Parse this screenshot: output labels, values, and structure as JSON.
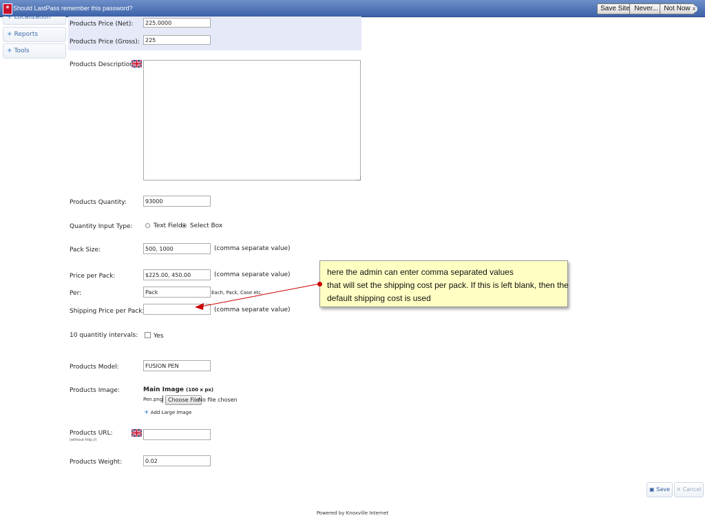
{
  "lastpass": {
    "message": "Should LastPass remember this password?",
    "save_site": "Save Site",
    "never": "Never...",
    "not_now": "Not Now",
    "close": "x",
    "logo": "*"
  },
  "sidebar": {
    "items": [
      {
        "label": "Localization"
      },
      {
        "label": "Reports"
      },
      {
        "label": "Tools"
      }
    ],
    "plus": "+"
  },
  "form": {
    "price_net": {
      "label": "Products Price (Net):",
      "value": "225.0000"
    },
    "price_gross": {
      "label": "Products Price (Gross):",
      "value": "225"
    },
    "description": {
      "label": "Products Description:",
      "value": ""
    },
    "quantity": {
      "label": "Products Quantity:",
      "value": "93000"
    },
    "quantity_input_type": {
      "label": "Quantity Input Type:",
      "options": [
        "Text Field",
        "Select Box"
      ],
      "selected": "Select Box"
    },
    "pack_size": {
      "label": "Pack Size:",
      "value": "500, 1000",
      "hint": "(comma separate value)"
    },
    "price_per_pack": {
      "label": "Price per Pack:",
      "value": "$225.00, 450.00",
      "hint": "(comma separate value)"
    },
    "per": {
      "label": "Per:",
      "value": "Pack",
      "hint": "Each, Pack, Case etc."
    },
    "shipping_price_per_pack": {
      "label": "Shipping Price per Pack:",
      "value": "",
      "hint": "(comma separate value)"
    },
    "quantity_intervals": {
      "label": "10 quantitiy intervals:",
      "option": "Yes"
    },
    "model": {
      "label": "Products Model:",
      "value": "FUSION PEN"
    },
    "image": {
      "label": "Products Image:",
      "main_image": "Main Image",
      "main_image_size": "(100 x px)",
      "current_file": "Pen.png",
      "choose_file": "Choose File",
      "no_file": "No file chosen",
      "add_large": "Add Large Image",
      "add_plus": "+"
    },
    "url": {
      "label": "Products URL:",
      "sublabel": "(without http://)",
      "value": ""
    },
    "weight": {
      "label": "Products Weight:",
      "value": "0.02"
    }
  },
  "callout": {
    "lines": [
      "here the admin can enter comma separated values",
      "that will set the shipping cost per pack. If this is left blank, then the",
      "default shipping cost is used"
    ],
    "arrow_color": "#cc0000"
  },
  "actions": {
    "save": "Save",
    "cancel": "Cancel"
  },
  "footer": {
    "powered_by": "Powered by Knoxville Internet"
  },
  "colors": {
    "lastpass_bar": "#3c62a8",
    "price_section_bg": "#e6e9f8",
    "callout_bg": "#ffffc4",
    "link_blue": "#3d6aa8"
  }
}
